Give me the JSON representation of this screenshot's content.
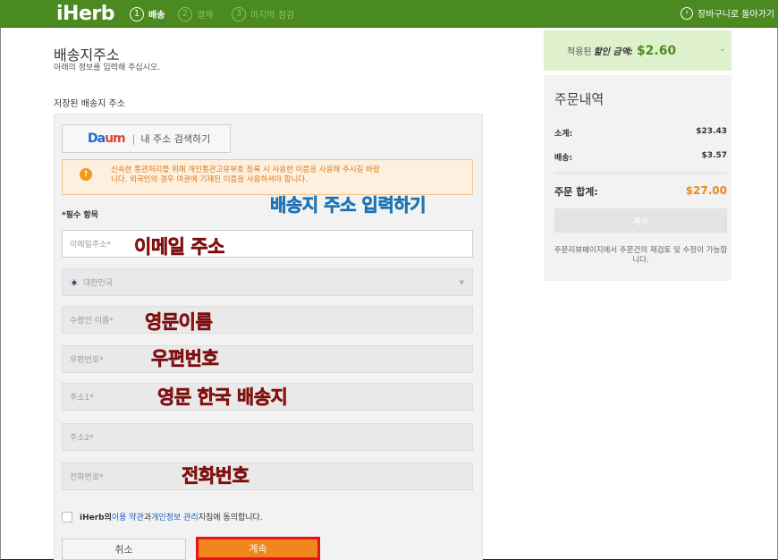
{
  "header": {
    "logo": "iHerb",
    "steps": [
      {
        "num": "1",
        "label": "배송"
      },
      {
        "num": "2",
        "label": "결제"
      },
      {
        "num": "3",
        "label": "마지막 점검"
      }
    ],
    "back_icon": "chevron-left-circle-icon",
    "back_label": "장바구니로 돌아가기"
  },
  "main": {
    "title": "배송지주소",
    "subtitle": "아래의 정보를 입력해 주십시오.",
    "saved_address_label": "저장된 배송지 주소",
    "daum_button": {
      "logo_left": "Da",
      "logo_right": "um",
      "separator": "|",
      "label": "내 주소 검색하기"
    },
    "notice": {
      "icon": "info-icon",
      "text_line1": "신속한 통관처리를 위해 개인통관고유부호 등록 시 사용한 이름을 사용해 주시길 바랍",
      "text_line2": "니다. 외국인의 경우 여권에 기재된 이름을 사용하셔야 합니다."
    },
    "required_label": "*필수 항목",
    "fields": {
      "email": "이메일주소*",
      "country": "대한민국",
      "recipient_name": "수령인 이름*",
      "postal_code": "우편번호*",
      "address1": "주소1*",
      "address2": "주소2*",
      "phone": "전화번호*"
    },
    "agreement": {
      "prefix": "iHerb의 ",
      "terms_link": "이용 약관",
      "middle": "과 ",
      "privacy_link": "개인정보 관리",
      "suffix": " 지침에 동의합니다."
    },
    "cancel_label": "취소",
    "continue_label": "계속"
  },
  "annotations": {
    "header": "배송지 주소 입력하기",
    "email": "이메일 주소",
    "name": "영문이름",
    "postal": "우편번호",
    "address": "영문 한국 배송지",
    "phone": "전화번호"
  },
  "sidebar": {
    "discount": {
      "prefix": "적용된",
      "emph": "할인 금액:",
      "amount": "$2.60",
      "chevron_icon": "chevron-down-icon"
    },
    "summary_title": "주문내역",
    "subtotal_label": "소계:",
    "subtotal_value": "$23.43",
    "shipping_label": "배송:",
    "shipping_value": "$3.57",
    "total_label": "주문 합계:",
    "total_value": "$27.00",
    "continue_label": "계속",
    "note": "주문리뷰페이지에서 주문건의 재검토 및 수정이 가능합니다."
  },
  "colors": {
    "brand_green": "#4a8a20",
    "accent_orange": "#f0861c",
    "annotation_red": "#d81b1b",
    "annotation_blue": "#2aa7e6"
  }
}
